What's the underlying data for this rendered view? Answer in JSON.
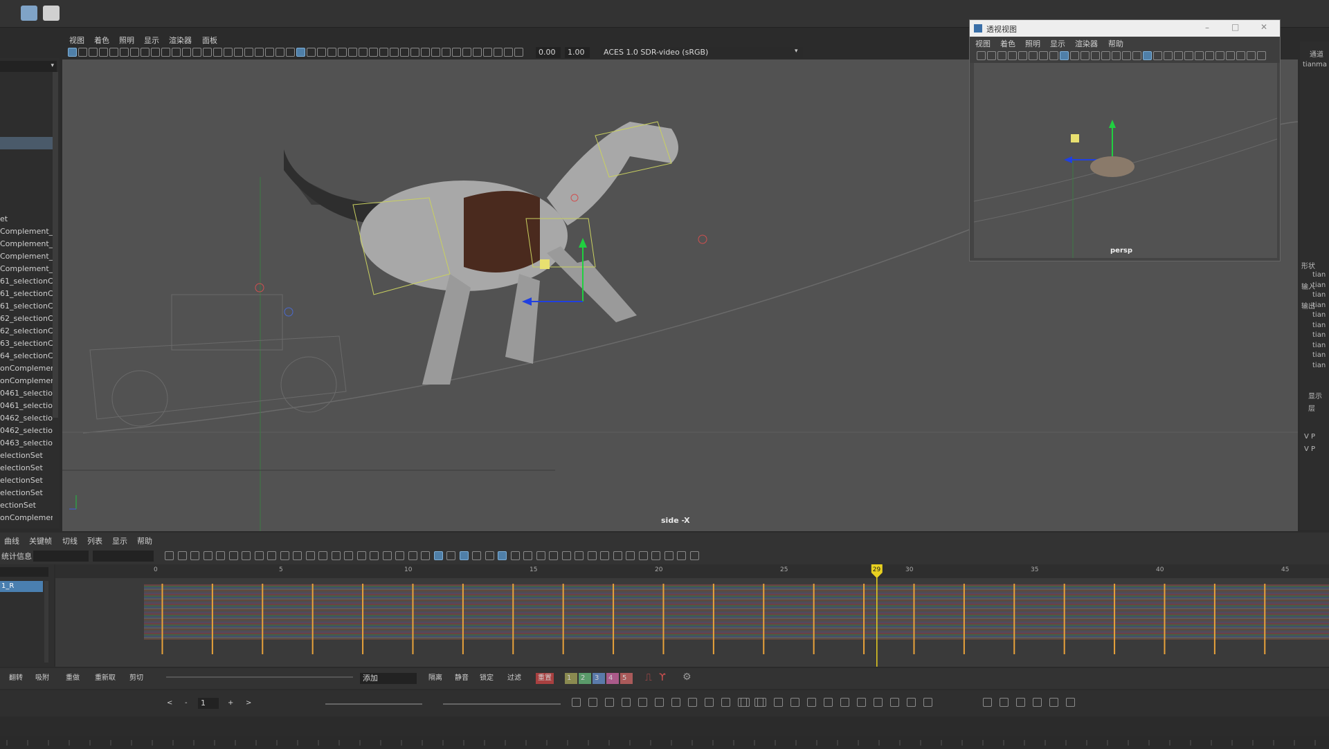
{
  "main_viewport": {
    "menu": [
      "视图",
      "着色",
      "照明",
      "显示",
      "渲染器",
      "面板"
    ],
    "exposure": "0.00",
    "gamma": "1.00",
    "color_space": "ACES 1.0 SDR-video (sRGB)",
    "camera_label": "side -X"
  },
  "outliner": {
    "items": [
      "et",
      "Complement_S",
      "Complement_S",
      "Complement_S",
      "Complement_S",
      "61_selectionC",
      "61_selectionC",
      "61_selectionC",
      "62_selectionC",
      "62_selectionC",
      "63_selectionC",
      "64_selectionC",
      "onComplemer",
      "onComplemer",
      "0461_selectio",
      "0461_selectio",
      "0462_selectio",
      "0462_selectio",
      "0463_selectio",
      "electionSet",
      "electionSet",
      "electionSet",
      "electionSet",
      "ectionSet",
      "onComplemen"
    ]
  },
  "persp_window": {
    "title": "透视视图",
    "menu": [
      "视图",
      "着色",
      "照明",
      "显示",
      "渲染器",
      "帮助"
    ],
    "camera_label": "persp"
  },
  "right_panel": {
    "top_label": "通道",
    "name": "tianma",
    "shape_label": "形状",
    "input_label": "输入",
    "output_label": "输出",
    "display_label": "显示",
    "layer_label": "层",
    "rows": [
      "tian",
      "tian",
      "tian",
      "tian",
      "tian",
      "tian",
      "tian",
      "tian",
      "tian",
      "tian"
    ],
    "vp_rows": [
      "V  P",
      "V  P"
    ]
  },
  "graph_editor": {
    "menu": [
      "曲线",
      "关键帧",
      "切线",
      "列表",
      "显示",
      "帮助"
    ],
    "stats_label": "统计信息",
    "selected_curve": "1_R",
    "ruler_ticks": [
      "0",
      "5",
      "10",
      "15",
      "20",
      "25",
      "30",
      "35",
      "40",
      "45"
    ],
    "current_frame": "29",
    "bottom_buttons": [
      "翻转",
      "吸附",
      "重做",
      "重新取",
      "剪切"
    ],
    "add_mode": "添加",
    "buttons2": [
      "隔离",
      "静音",
      "锁定",
      "过滤",
      "重置"
    ],
    "layer_nums": [
      "1",
      "2",
      "3",
      "4",
      "5"
    ]
  },
  "time_controls": {
    "frame_field": "1",
    "prev": "<",
    "minus": "-",
    "plus": "+",
    "next": ">"
  },
  "colors": {
    "key_line": "#e8a23a",
    "current_time": "#e8d020",
    "accent": "#4f7fa8"
  }
}
